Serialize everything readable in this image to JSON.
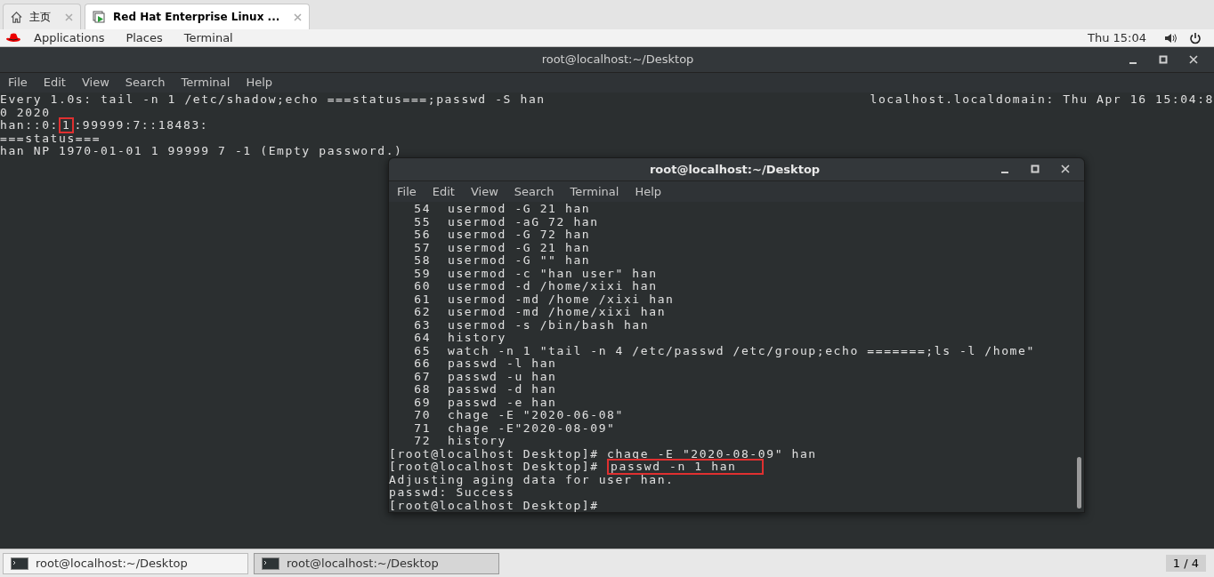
{
  "browser_tabs": [
    {
      "label": "主页",
      "selected": false
    },
    {
      "label": "Red Hat Enterprise Linux ...",
      "selected": true
    }
  ],
  "top_bar": {
    "menus": [
      "Applications",
      "Places",
      "Terminal"
    ],
    "clock": "Thu 15:04"
  },
  "back_terminal": {
    "title": "root@localhost:~/Desktop",
    "menu": [
      "File",
      "Edit",
      "View",
      "Search",
      "Terminal",
      "Help"
    ],
    "header_left": "Every 1.0s: tail -n 1 /etc/shadow;echo ===status===;passwd -S han",
    "header_right": "localhost.localdomain: Thu Apr 16 15:04:8",
    "lines": [
      [
        {
          "text": "0 2020",
          "highlighted": false
        }
      ],
      [
        {
          "text": "han::0:",
          "highlighted": false
        },
        {
          "text": "1",
          "highlighted": true
        },
        {
          "text": ":99999:7::18483:",
          "highlighted": false
        }
      ],
      [
        {
          "text": "===status===",
          "highlighted": false
        }
      ],
      [
        {
          "text": "han NP 1970-01-01 1 99999 7 -1 (Empty password.)",
          "highlighted": false
        }
      ]
    ]
  },
  "front_terminal": {
    "title": "root@localhost:~/Desktop",
    "menu": [
      "File",
      "Edit",
      "View",
      "Search",
      "Terminal",
      "Help"
    ],
    "lines": [
      [
        {
          "text": "   54  usermod -G 21 han",
          "highlighted": false
        }
      ],
      [
        {
          "text": "   55  usermod -aG 72 han",
          "highlighted": false
        }
      ],
      [
        {
          "text": "   56  usermod -G 72 han",
          "highlighted": false
        }
      ],
      [
        {
          "text": "   57  usermod -G 21 han",
          "highlighted": false
        }
      ],
      [
        {
          "text": "   58  usermod -G \"\" han",
          "highlighted": false
        }
      ],
      [
        {
          "text": "   59  usermod -c \"han user\" han",
          "highlighted": false
        }
      ],
      [
        {
          "text": "   60  usermod -d /home/xixi han",
          "highlighted": false
        }
      ],
      [
        {
          "text": "   61  usermod -md /home /xixi han",
          "highlighted": false
        }
      ],
      [
        {
          "text": "   62  usermod -md /home/xixi han",
          "highlighted": false
        }
      ],
      [
        {
          "text": "   63  usermod -s /bin/bash han",
          "highlighted": false
        }
      ],
      [
        {
          "text": "   64  history",
          "highlighted": false
        }
      ],
      [
        {
          "text": "   65  watch -n 1 \"tail -n 4 /etc/passwd /etc/group;echo =======;ls -l /home\"",
          "highlighted": false
        }
      ],
      [
        {
          "text": "   66  passwd -l han",
          "highlighted": false
        }
      ],
      [
        {
          "text": "   67  passwd -u han",
          "highlighted": false
        }
      ],
      [
        {
          "text": "   68  passwd -d han",
          "highlighted": false
        }
      ],
      [
        {
          "text": "   69  passwd -e han",
          "highlighted": false
        }
      ],
      [
        {
          "text": "   70  chage -E \"2020-06-08\"",
          "highlighted": false
        }
      ],
      [
        {
          "text": "   71  chage -E\"2020-08-09\"",
          "highlighted": false
        }
      ],
      [
        {
          "text": "   72  history",
          "highlighted": false
        }
      ],
      [
        {
          "text": "[root@localhost Desktop]# chage -E \"2020-08-09\" han",
          "highlighted": false
        }
      ],
      [
        {
          "text": "[root@localhost Desktop]# ",
          "highlighted": false
        },
        {
          "text": "passwd -n 1 han",
          "highlighted": true
        }
      ],
      [
        {
          "text": "Adjusting aging data for user han.",
          "highlighted": false
        }
      ],
      [
        {
          "text": "passwd: Success",
          "highlighted": false
        }
      ],
      [
        {
          "text": "[root@localhost Desktop]#",
          "highlighted": false
        }
      ]
    ]
  },
  "taskbar": [
    {
      "label": "root@localhost:~/Desktop",
      "selected": false
    },
    {
      "label": "root@localhost:~/Desktop",
      "selected": true
    }
  ],
  "workspace": "1 / 4"
}
